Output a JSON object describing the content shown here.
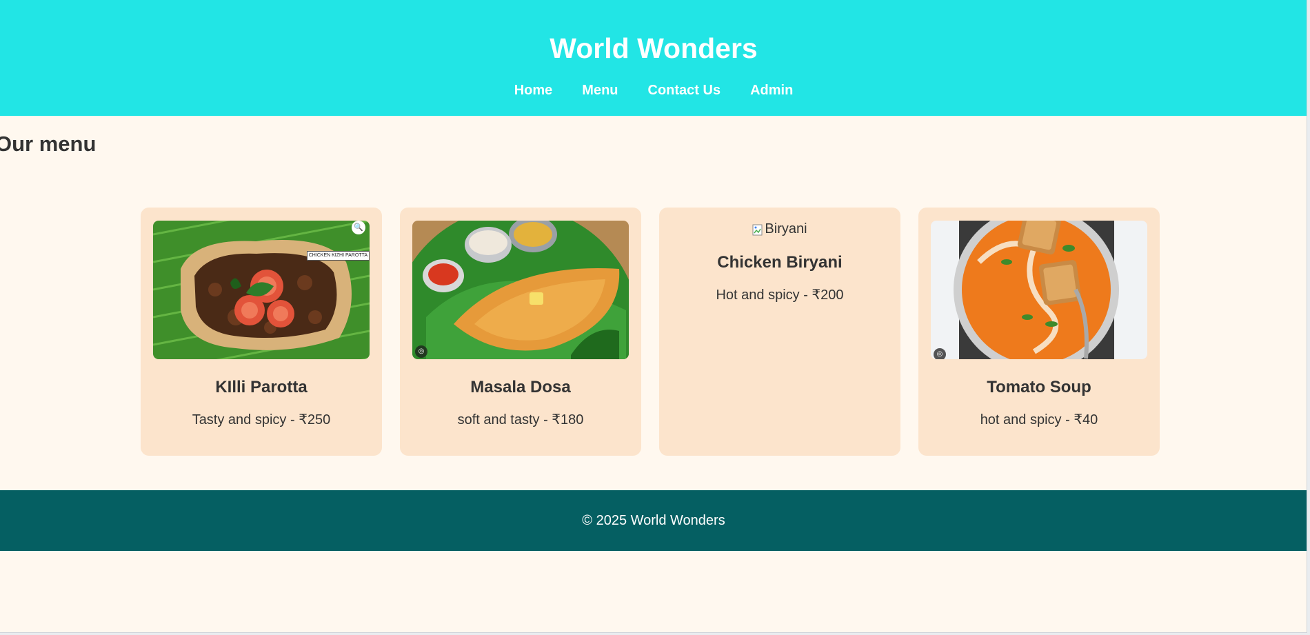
{
  "site": {
    "title": "World Wonders"
  },
  "nav": {
    "items": [
      {
        "label": "Home"
      },
      {
        "label": "Menu"
      },
      {
        "label": "Contact Us"
      },
      {
        "label": "Admin"
      }
    ]
  },
  "menu": {
    "heading": "Our menu",
    "items": [
      {
        "name": "KIlli Parotta",
        "description": "Tasty and spicy - ₹250",
        "image_caption": "CHICKEN KIZHI PAROTTA",
        "icon": "zoom-icon"
      },
      {
        "name": "Masala Dosa",
        "description": "soft and tasty - ₹180",
        "icon": "lens-icon"
      },
      {
        "name": "Chicken Biryani",
        "description": "Hot and spicy - ₹200",
        "image_alt": "Biryani"
      },
      {
        "name": "Tomato Soup",
        "description": "hot and spicy - ₹40",
        "icon": "lens-icon"
      }
    ]
  },
  "footer": {
    "text": "© 2025 World Wonders"
  },
  "colors": {
    "header_bg": "#22e5e5",
    "page_bg": "#fff8ef",
    "card_bg": "#fce4cc",
    "footer_bg": "#055f62",
    "text": "#333333"
  }
}
